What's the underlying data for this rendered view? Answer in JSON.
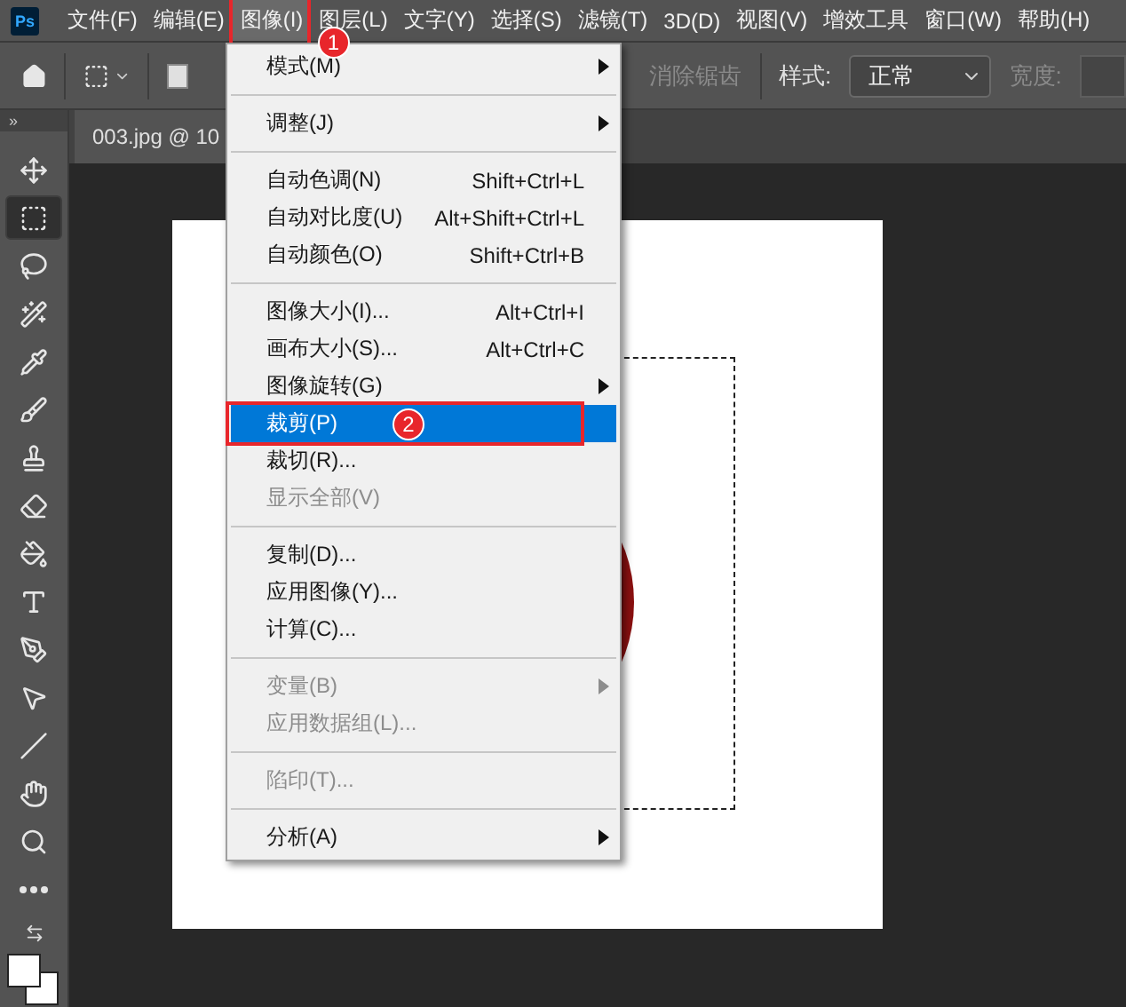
{
  "app_logo": "Ps",
  "menubar": [
    {
      "label": "文件(F)",
      "selected": false
    },
    {
      "label": "编辑(E)",
      "selected": false
    },
    {
      "label": "图像(I)",
      "selected": true,
      "callout": "1"
    },
    {
      "label": "图层(L)",
      "selected": false
    },
    {
      "label": "文字(Y)",
      "selected": false
    },
    {
      "label": "选择(S)",
      "selected": false
    },
    {
      "label": "滤镜(T)",
      "selected": false
    },
    {
      "label": "3D(D)",
      "selected": false
    },
    {
      "label": "视图(V)",
      "selected": false
    },
    {
      "label": "增效工具",
      "selected": false
    },
    {
      "label": "窗口(W)",
      "selected": false
    },
    {
      "label": "帮助(H)",
      "selected": false
    }
  ],
  "options_bar": {
    "anti_alias": {
      "label": "消除锯齿",
      "disabled": true
    },
    "style_label": "样式:",
    "style_value": "正常",
    "width_label": "宽度:"
  },
  "document_tab": {
    "title": "003.jpg @ 10"
  },
  "toolbar_collapse": "»",
  "tools": [
    {
      "kind": "move",
      "selected": false
    },
    {
      "kind": "marquee",
      "selected": true
    },
    {
      "kind": "lasso",
      "selected": false
    },
    {
      "kind": "quick-select",
      "selected": false
    },
    {
      "kind": "eyedropper",
      "selected": false
    },
    {
      "kind": "brush",
      "selected": false
    },
    {
      "kind": "stamp",
      "selected": false
    },
    {
      "kind": "eraser",
      "selected": false
    },
    {
      "kind": "bucket",
      "selected": false
    },
    {
      "kind": "type",
      "selected": false
    },
    {
      "kind": "pen",
      "selected": false
    },
    {
      "kind": "pointer",
      "selected": false
    },
    {
      "kind": "line",
      "selected": false
    },
    {
      "kind": "hand",
      "selected": false
    },
    {
      "kind": "zoom",
      "selected": false
    },
    {
      "kind": "more",
      "selected": false
    }
  ],
  "menu": [
    {
      "kind": "item",
      "label": "模式(M)",
      "submenu": true,
      "disabled": false,
      "selected": false
    },
    {
      "kind": "separator"
    },
    {
      "kind": "item",
      "label": "调整(J)",
      "submenu": true,
      "disabled": false,
      "selected": false
    },
    {
      "kind": "separator"
    },
    {
      "kind": "item",
      "label": "自动色调(N)",
      "shortcut": "Shift+Ctrl+L",
      "disabled": false,
      "selected": false
    },
    {
      "kind": "item",
      "label": "自动对比度(U)",
      "shortcut": "Alt+Shift+Ctrl+L",
      "disabled": false,
      "selected": false
    },
    {
      "kind": "item",
      "label": "自动颜色(O)",
      "shortcut": "Shift+Ctrl+B",
      "disabled": false,
      "selected": false
    },
    {
      "kind": "separator"
    },
    {
      "kind": "item",
      "label": "图像大小(I)...",
      "shortcut": "Alt+Ctrl+I",
      "disabled": false,
      "selected": false
    },
    {
      "kind": "item",
      "label": "画布大小(S)...",
      "shortcut": "Alt+Ctrl+C",
      "disabled": false,
      "selected": false
    },
    {
      "kind": "item",
      "label": "图像旋转(G)",
      "submenu": true,
      "disabled": false,
      "selected": false
    },
    {
      "kind": "item",
      "label": "裁剪(P)",
      "disabled": false,
      "selected": true,
      "callout": "2"
    },
    {
      "kind": "item",
      "label": "裁切(R)...",
      "disabled": false,
      "selected": false
    },
    {
      "kind": "item",
      "label": "显示全部(V)",
      "disabled": true,
      "selected": false
    },
    {
      "kind": "separator"
    },
    {
      "kind": "item",
      "label": "复制(D)...",
      "disabled": false,
      "selected": false
    },
    {
      "kind": "item",
      "label": "应用图像(Y)...",
      "disabled": false,
      "selected": false
    },
    {
      "kind": "item",
      "label": "计算(C)...",
      "disabled": false,
      "selected": false
    },
    {
      "kind": "separator"
    },
    {
      "kind": "item",
      "label": "变量(B)",
      "submenu": true,
      "disabled": true,
      "selected": false
    },
    {
      "kind": "item",
      "label": "应用数据组(L)...",
      "disabled": true,
      "selected": false
    },
    {
      "kind": "separator"
    },
    {
      "kind": "item",
      "label": "陷印(T)...",
      "disabled": true,
      "selected": false
    },
    {
      "kind": "separator"
    },
    {
      "kind": "item",
      "label": "分析(A)",
      "submenu": true,
      "disabled": false,
      "selected": false
    }
  ]
}
